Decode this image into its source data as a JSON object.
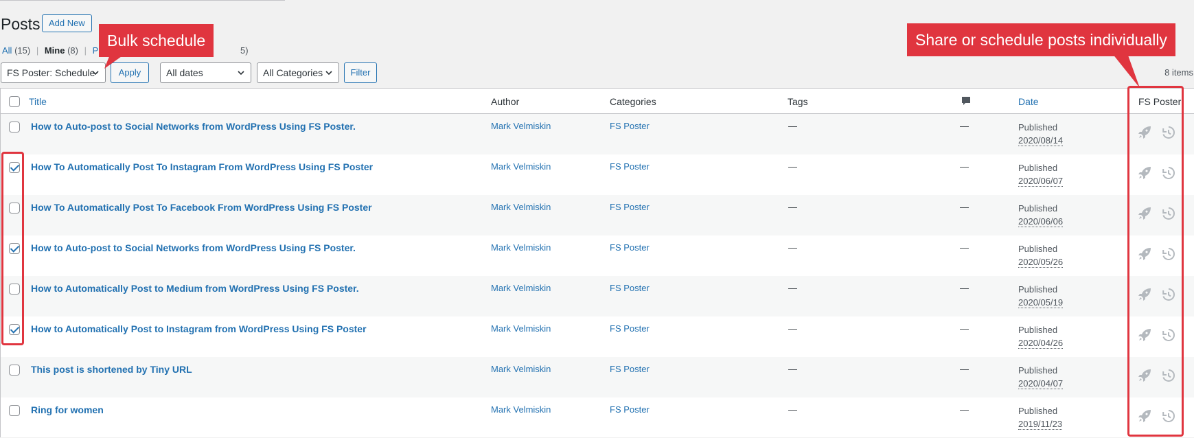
{
  "header": {
    "title": "Posts",
    "add_new": "Add New"
  },
  "views": {
    "all_label": "All",
    "all_count": "(15)",
    "mine_label": "Mine",
    "mine_count": "(8)",
    "pub_partial": "Pub",
    "tail_partial": "5)"
  },
  "actions": {
    "bulk_action": "FS Poster: Schedule",
    "apply": "Apply",
    "dates": "All dates",
    "categories": "All Categories",
    "filter": "Filter",
    "items_count": "8 items"
  },
  "table": {
    "columns": {
      "title": "Title",
      "author": "Author",
      "categories": "Categories",
      "tags": "Tags",
      "comments_icon": "comment-bubble-icon",
      "date": "Date",
      "fs_poster": "FS Poster"
    },
    "rows": [
      {
        "title": "How to Auto-post to Social Networks from WordPress Using FS Poster.",
        "author": "Mark Velmiskin",
        "category": "FS Poster",
        "tags": "—",
        "comments": "—",
        "status": "Published",
        "date": "2020/08/14",
        "checked": false
      },
      {
        "title": "How To Automatically Post To Instagram From WordPress Using FS Poster",
        "author": "Mark Velmiskin",
        "category": "FS Poster",
        "tags": "—",
        "comments": "—",
        "status": "Published",
        "date": "2020/06/07",
        "checked": true
      },
      {
        "title": "How To Automatically Post To Facebook From WordPress Using FS Poster",
        "author": "Mark Velmiskin",
        "category": "FS Poster",
        "tags": "—",
        "comments": "—",
        "status": "Published",
        "date": "2020/06/06",
        "checked": false
      },
      {
        "title": "How to Auto-post to Social Networks from WordPress Using FS Poster.",
        "author": "Mark Velmiskin",
        "category": "FS Poster",
        "tags": "—",
        "comments": "—",
        "status": "Published",
        "date": "2020/05/26",
        "checked": true
      },
      {
        "title": "How to Automatically Post to Medium from WordPress Using FS Poster.",
        "author": "Mark Velmiskin",
        "category": "FS Poster",
        "tags": "—",
        "comments": "—",
        "status": "Published",
        "date": "2020/05/19",
        "checked": false
      },
      {
        "title": "How to Automatically Post to Instagram from WordPress Using FS Poster",
        "author": "Mark Velmiskin",
        "category": "FS Poster",
        "tags": "—",
        "comments": "—",
        "status": "Published",
        "date": "2020/04/26",
        "checked": true
      },
      {
        "title": "This post is shortened by Tiny URL",
        "author": "Mark Velmiskin",
        "category": "FS Poster",
        "tags": "—",
        "comments": "—",
        "status": "Published",
        "date": "2020/04/07",
        "checked": false
      },
      {
        "title": "Ring for women",
        "author": "Mark Velmiskin",
        "category": "FS Poster",
        "tags": "—",
        "comments": "—",
        "status": "Published",
        "date": "2019/11/23",
        "checked": false
      }
    ],
    "row_icons": {
      "share": "rocket-icon",
      "schedule": "history-icon"
    }
  },
  "annotations": {
    "bulk": "Bulk schedule",
    "individual": "Share or schedule posts individually"
  },
  "colors": {
    "link": "#2271b1",
    "annotation": "#e0353f",
    "background": "#f1f1f1"
  }
}
